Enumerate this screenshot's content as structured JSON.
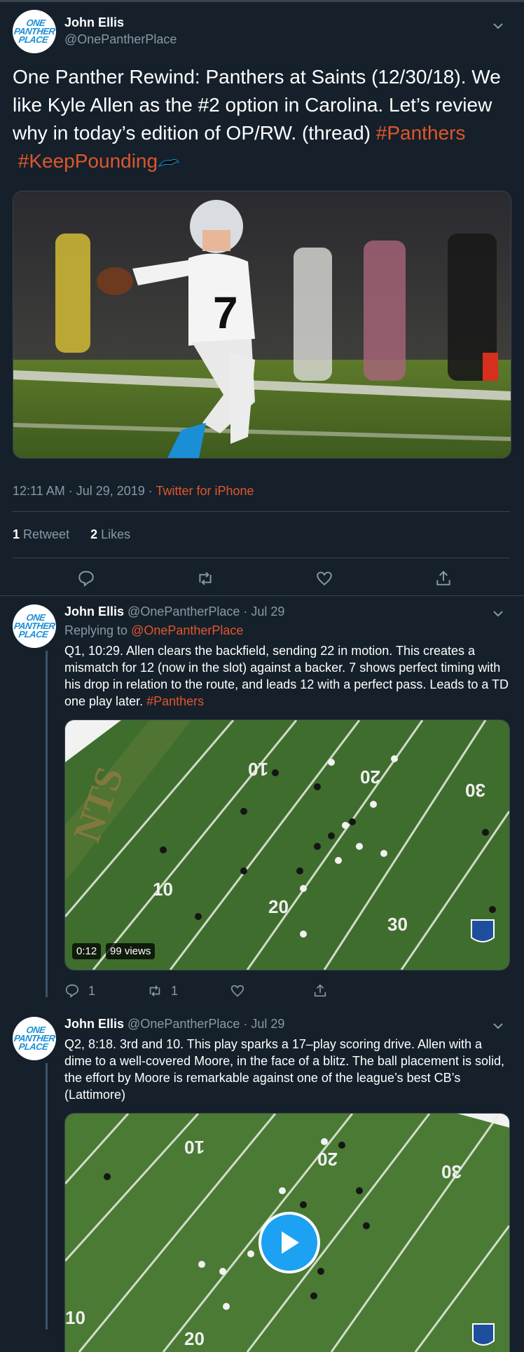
{
  "main_tweet": {
    "name": "John Ellis",
    "handle": "@OnePantherPlace",
    "avatar_text": [
      "ONE",
      "PANTHER",
      "PLACE"
    ],
    "text_plain": "One Panther Rewind: Panthers at Saints (12/30/18). We like Kyle Allen as the #2 option in Carolina. Let’s review why in today’s edition of OP/RW. (thread) ",
    "hashtag1": "#Panthers",
    "hashtag2": "#KeepPounding",
    "jersey_number": "7",
    "timestamp": "12:11 AM · Jul 29, 2019 · ",
    "source": "Twitter for iPhone",
    "retweets_count": "1",
    "retweets_label": "Retweet",
    "likes_count": "2",
    "likes_label": "Likes"
  },
  "thread": [
    {
      "name": "John Ellis",
      "handle_date": "@OnePantherPlace · Jul 29",
      "replying_label": "Replying to ",
      "replying_handle": "@OnePantherPlace",
      "text": "Q1, 10:29. Allen clears the backfield, sending 22 in motion. This creates a mismatch for 12 (now in the slot) against a backer. 7 shows perfect timing with his drop in relation to the route, and leads 12  with a perfect pass. Leads to a TD one play later. ",
      "hashtag": "#Panthers",
      "video_time": "0:12",
      "video_views": "99 views",
      "replies": "1",
      "retweets": "1",
      "field_numbers": [
        "10",
        "20",
        "30",
        "10",
        "20",
        "30"
      ]
    },
    {
      "name": "John Ellis",
      "handle_date": "@OnePantherPlace · Jul 29",
      "text": "Q2, 8:18. 3rd and 10. This play sparks a 17–play scoring drive. Allen with a dime to a well-covered Moore, in the face of a blitz. The ball placement is solid, the effort by Moore is remarkable against one of the league’s best CB’s (Lattimore)",
      "field_numbers": [
        "10",
        "20",
        "30",
        "10",
        "20"
      ]
    }
  ],
  "colors": {
    "background": "#15202b",
    "accent": "#e0562b",
    "muted": "#8899a6",
    "border": "#38444d",
    "play": "#1da1f2"
  }
}
